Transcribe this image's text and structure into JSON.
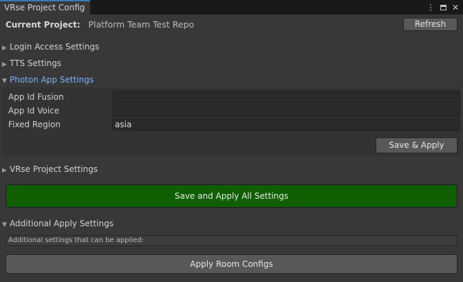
{
  "window": {
    "tab_title": "VRse Project Config",
    "menu_icon": "kebab-menu-icon",
    "maximize_icon": "maximize-icon",
    "close_icon": "close-icon"
  },
  "header": {
    "current_project_label": "Current Project:",
    "current_project_value": "Platform Team Test Repo",
    "refresh_label": "Refresh"
  },
  "sections": {
    "login": {
      "label": "Login Access Settings",
      "expanded": false
    },
    "tts": {
      "label": "TTS Settings",
      "expanded": false
    },
    "photon": {
      "label": "Photon App Settings",
      "expanded": true,
      "fields": [
        {
          "label": "App Id Fusion",
          "value": ""
        },
        {
          "label": "App Id Voice",
          "value": ""
        },
        {
          "label": "Fixed Region",
          "value": "asia"
        }
      ],
      "save_apply_label": "Save & Apply"
    },
    "vrse": {
      "label": "VRse Project Settings",
      "expanded": false
    },
    "additional": {
      "label": "Additional Apply Settings",
      "expanded": true,
      "help_text": "Additional settings that can be applied:",
      "apply_room_label": "Apply Room Configs"
    }
  },
  "save_all_label": "Save and Apply All Settings",
  "colors": {
    "accent_tab": "#3a79bb",
    "expanded_label": "#7ab3f5",
    "primary_button": "#0f5f02"
  }
}
